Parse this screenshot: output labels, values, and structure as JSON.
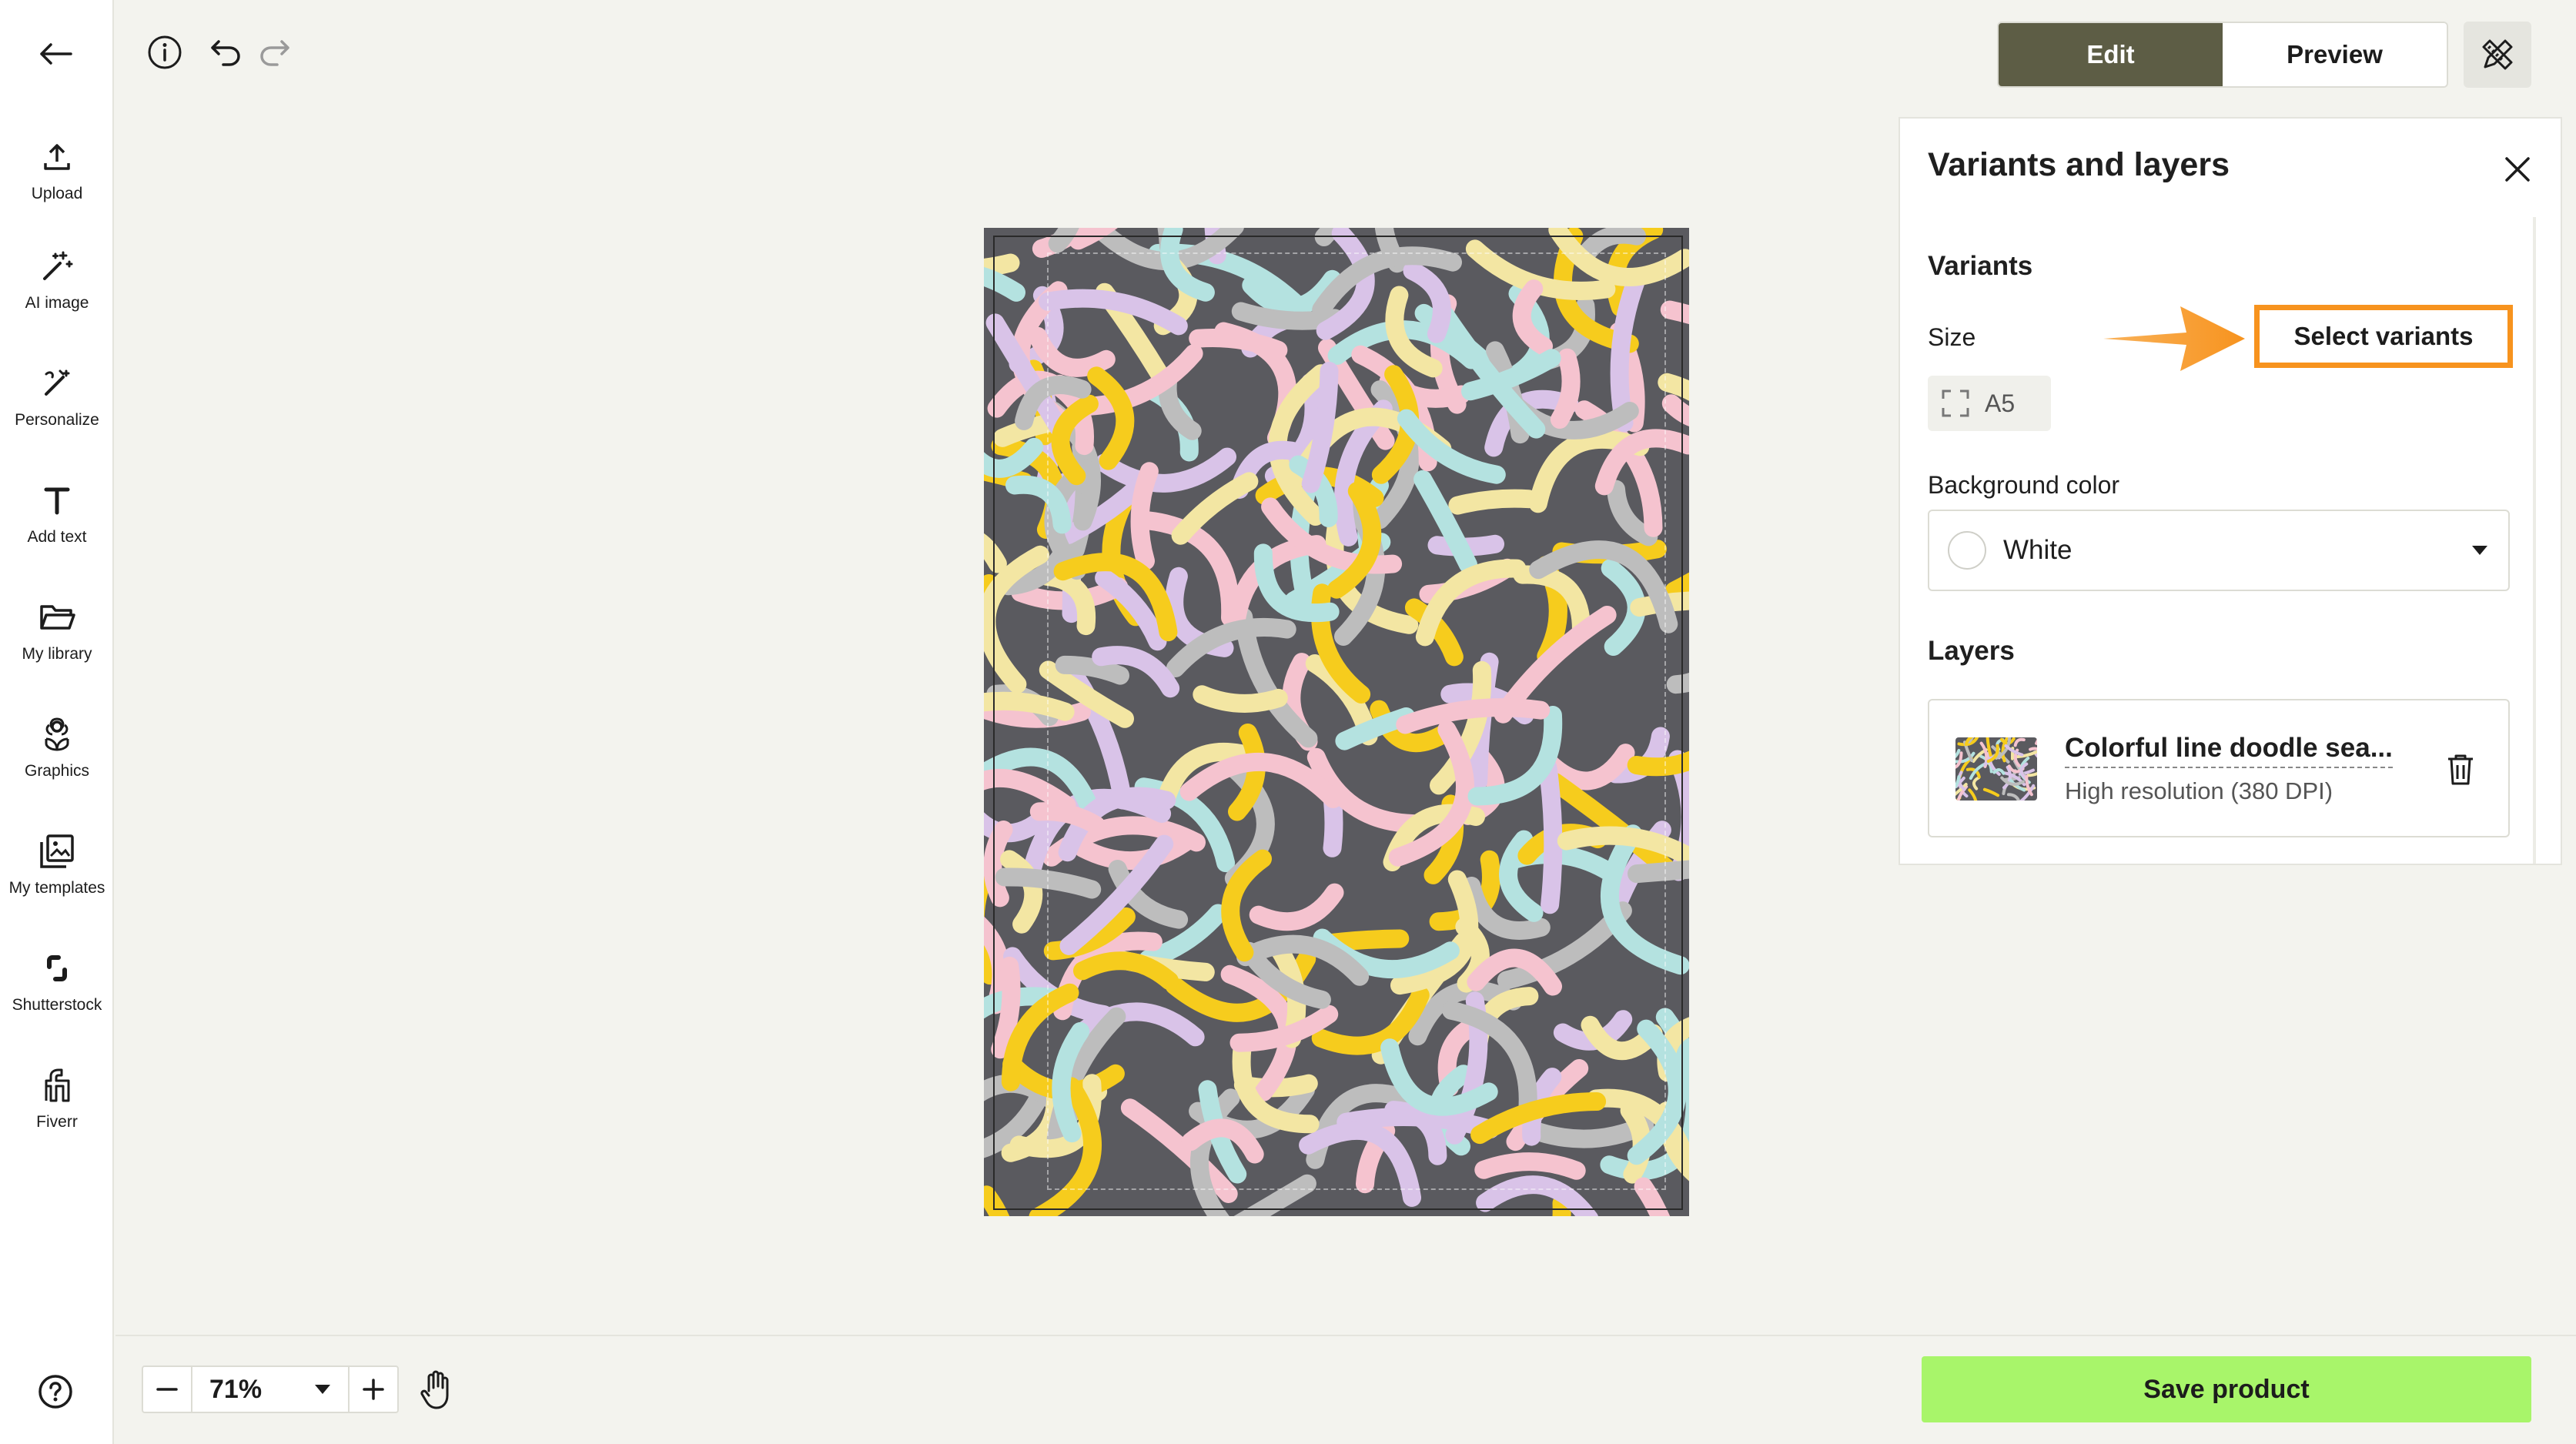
{
  "sidebar": {
    "items": [
      {
        "label": "Upload",
        "icon": "upload-icon"
      },
      {
        "label": "AI image",
        "icon": "magic-wand-icon"
      },
      {
        "label": "Personalize",
        "icon": "personalize-icon"
      },
      {
        "label": "Add text",
        "icon": "text-icon"
      },
      {
        "label": "My library",
        "icon": "folder-icon"
      },
      {
        "label": "Graphics",
        "icon": "flower-icon"
      },
      {
        "label": "My templates",
        "icon": "templates-icon"
      },
      {
        "label": "Shutterstock",
        "icon": "shutterstock-icon"
      },
      {
        "label": "Fiverr",
        "icon": "fiverr-icon"
      }
    ]
  },
  "toolbar": {
    "edit_label": "Edit",
    "preview_label": "Preview"
  },
  "panel": {
    "title": "Variants and layers",
    "variants_heading": "Variants",
    "size_label": "Size",
    "size_value": "A5",
    "select_variants_label": "Select variants",
    "background_label": "Background color",
    "background_value": "White",
    "layers_heading": "Layers",
    "layer": {
      "name": "Colorful line doodle sea...",
      "resolution": "High resolution (380 DPI)"
    }
  },
  "zoom": {
    "value": "71%"
  },
  "save_label": "Save product",
  "colors": {
    "accent_dark": "#5d5d45",
    "save_green": "#a8f56a",
    "highlight_orange": "#f7931e",
    "pattern_bg": "#5a5a5f",
    "pattern_colors": [
      "#f5c3cf",
      "#f3e6a3",
      "#b4e2e0",
      "#d9c3e8",
      "#bdbdbd",
      "#f6cc1d"
    ]
  }
}
